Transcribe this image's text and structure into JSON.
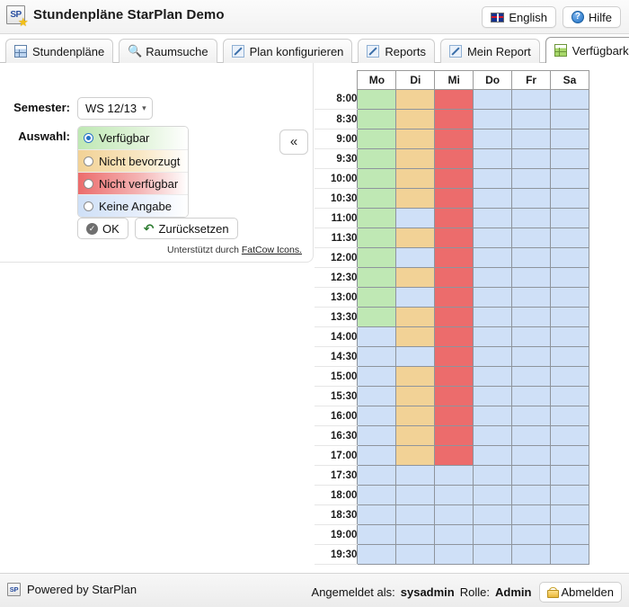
{
  "header": {
    "title": "Stundenpläne StarPlan Demo",
    "logo_text": "SP",
    "logo_icon": "starplan-logo-icon",
    "language_button": "English",
    "language_icon": "uk-flag-icon",
    "help_button": "Hilfe",
    "help_icon": "help-circle-icon"
  },
  "tabs": [
    {
      "label": "Stundenpläne",
      "icon": "grid-icon",
      "active": false
    },
    {
      "label": "Raumsuche",
      "icon": "search-icon",
      "active": false
    },
    {
      "label": "Plan konfigurieren",
      "icon": "pencil-icon",
      "active": false
    },
    {
      "label": "Reports",
      "icon": "pencil-icon",
      "active": false
    },
    {
      "label": "Mein Report",
      "icon": "pencil-icon",
      "active": false
    },
    {
      "label": "Verfügbarkeit",
      "icon": "green-grid-icon",
      "active": true
    }
  ],
  "panel": {
    "collapse_icon": "«",
    "semester_label": "Semester:",
    "semester_value": "WS 12/13",
    "semester_options": [
      "WS 12/13"
    ],
    "auswahl_label": "Auswahl:",
    "options": [
      {
        "label": "Verfügbar",
        "selected": true,
        "color": "#bfe8b4"
      },
      {
        "label": "Nicht bevorzugt",
        "selected": false,
        "color": "#f2d296"
      },
      {
        "label": "Nicht verfügbar",
        "selected": false,
        "color": "#ec6c6c"
      },
      {
        "label": "Keine Angabe",
        "selected": false,
        "color": "#cfe0f7"
      }
    ],
    "ok_button": "OK",
    "ok_icon": "check-circle-icon",
    "reset_button": "Zurücksetzen",
    "reset_icon": "undo-arrow-icon",
    "credit_prefix": "Unterstützt durch ",
    "credit_link": "FatCow Icons."
  },
  "grid": {
    "days": [
      "Mo",
      "Di",
      "Mi",
      "Do",
      "Fr",
      "Sa"
    ],
    "times": [
      "8:00",
      "8:30",
      "9:00",
      "9:30",
      "10:00",
      "10:30",
      "11:00",
      "11:30",
      "12:00",
      "12:30",
      "13:00",
      "13:30",
      "14:00",
      "14:30",
      "15:00",
      "15:30",
      "16:00",
      "16:30",
      "17:00",
      "17:30",
      "18:00",
      "18:30",
      "19:00",
      "19:30"
    ],
    "legend": {
      "green": "Verfügbar",
      "orange": "Nicht bevorzugt",
      "red": "Nicht verfügbar",
      "blue": "Keine Angabe"
    },
    "cells": [
      [
        "green",
        "orange",
        "red",
        "blue",
        "blue",
        "blue"
      ],
      [
        "green",
        "orange",
        "red",
        "blue",
        "blue",
        "blue"
      ],
      [
        "green",
        "orange",
        "red",
        "blue",
        "blue",
        "blue"
      ],
      [
        "green",
        "orange",
        "red",
        "blue",
        "blue",
        "blue"
      ],
      [
        "green",
        "orange",
        "red",
        "blue",
        "blue",
        "blue"
      ],
      [
        "green",
        "orange",
        "red",
        "blue",
        "blue",
        "blue"
      ],
      [
        "green",
        "blue",
        "red",
        "blue",
        "blue",
        "blue"
      ],
      [
        "green",
        "orange",
        "red",
        "blue",
        "blue",
        "blue"
      ],
      [
        "green",
        "blue",
        "red",
        "blue",
        "blue",
        "blue"
      ],
      [
        "green",
        "orange",
        "red",
        "blue",
        "blue",
        "blue"
      ],
      [
        "green",
        "blue",
        "red",
        "blue",
        "blue",
        "blue"
      ],
      [
        "green",
        "orange",
        "red",
        "blue",
        "blue",
        "blue"
      ],
      [
        "blue",
        "orange",
        "red",
        "blue",
        "blue",
        "blue"
      ],
      [
        "blue",
        "blue",
        "red",
        "blue",
        "blue",
        "blue"
      ],
      [
        "blue",
        "orange",
        "red",
        "blue",
        "blue",
        "blue"
      ],
      [
        "blue",
        "orange",
        "red",
        "blue",
        "blue",
        "blue"
      ],
      [
        "blue",
        "orange",
        "red",
        "blue",
        "blue",
        "blue"
      ],
      [
        "blue",
        "orange",
        "red",
        "blue",
        "blue",
        "blue"
      ],
      [
        "blue",
        "orange",
        "red",
        "blue",
        "blue",
        "blue"
      ],
      [
        "blue",
        "blue",
        "blue",
        "blue",
        "blue",
        "blue"
      ],
      [
        "blue",
        "blue",
        "blue",
        "blue",
        "blue",
        "blue"
      ],
      [
        "blue",
        "blue",
        "blue",
        "blue",
        "blue",
        "blue"
      ],
      [
        "blue",
        "blue",
        "blue",
        "blue",
        "blue",
        "blue"
      ],
      [
        "blue",
        "blue",
        "blue",
        "blue",
        "blue",
        "blue"
      ]
    ]
  },
  "footer": {
    "powered_by": "Powered by StarPlan",
    "logo_text": "SP",
    "logged_in_label": "Angemeldet als:",
    "username": "sysadmin",
    "role_label": "Rolle:",
    "role": "Admin",
    "logout_button": "Abmelden",
    "logout_icon": "lock-icon"
  }
}
